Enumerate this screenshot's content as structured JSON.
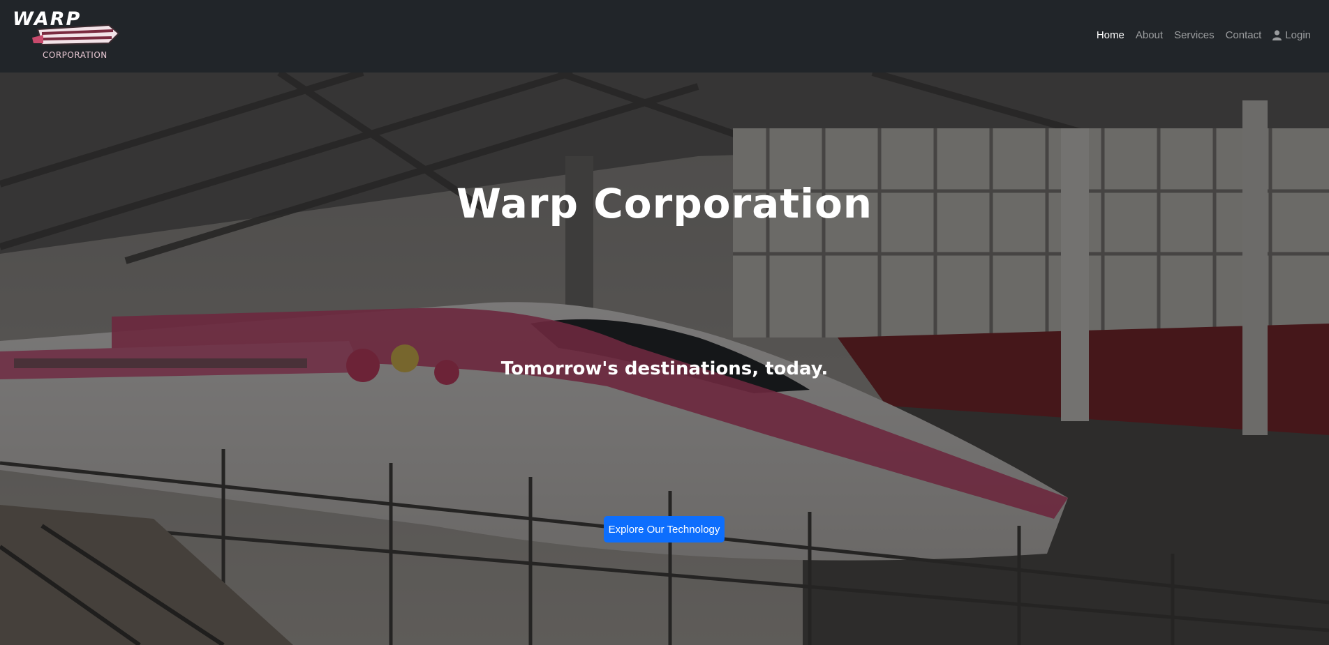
{
  "brand": {
    "logo_word": "WARP",
    "logo_sub": "CORPORATION"
  },
  "nav": {
    "items": [
      {
        "label": "Home",
        "active": true
      },
      {
        "label": "About",
        "active": false
      },
      {
        "label": "Services",
        "active": false
      },
      {
        "label": "Contact",
        "active": false
      }
    ],
    "login_label": "Login",
    "login_icon": "user-icon"
  },
  "hero": {
    "title": "Warp Corporation",
    "subtitle": "Tomorrow's destinations, today.",
    "cta_label": "Explore Our Technology",
    "background_image": "bullet-train-at-station",
    "colors": {
      "accent": "#0d6efd",
      "navbar": "#212529",
      "train_stripe": "#d8507c"
    }
  }
}
